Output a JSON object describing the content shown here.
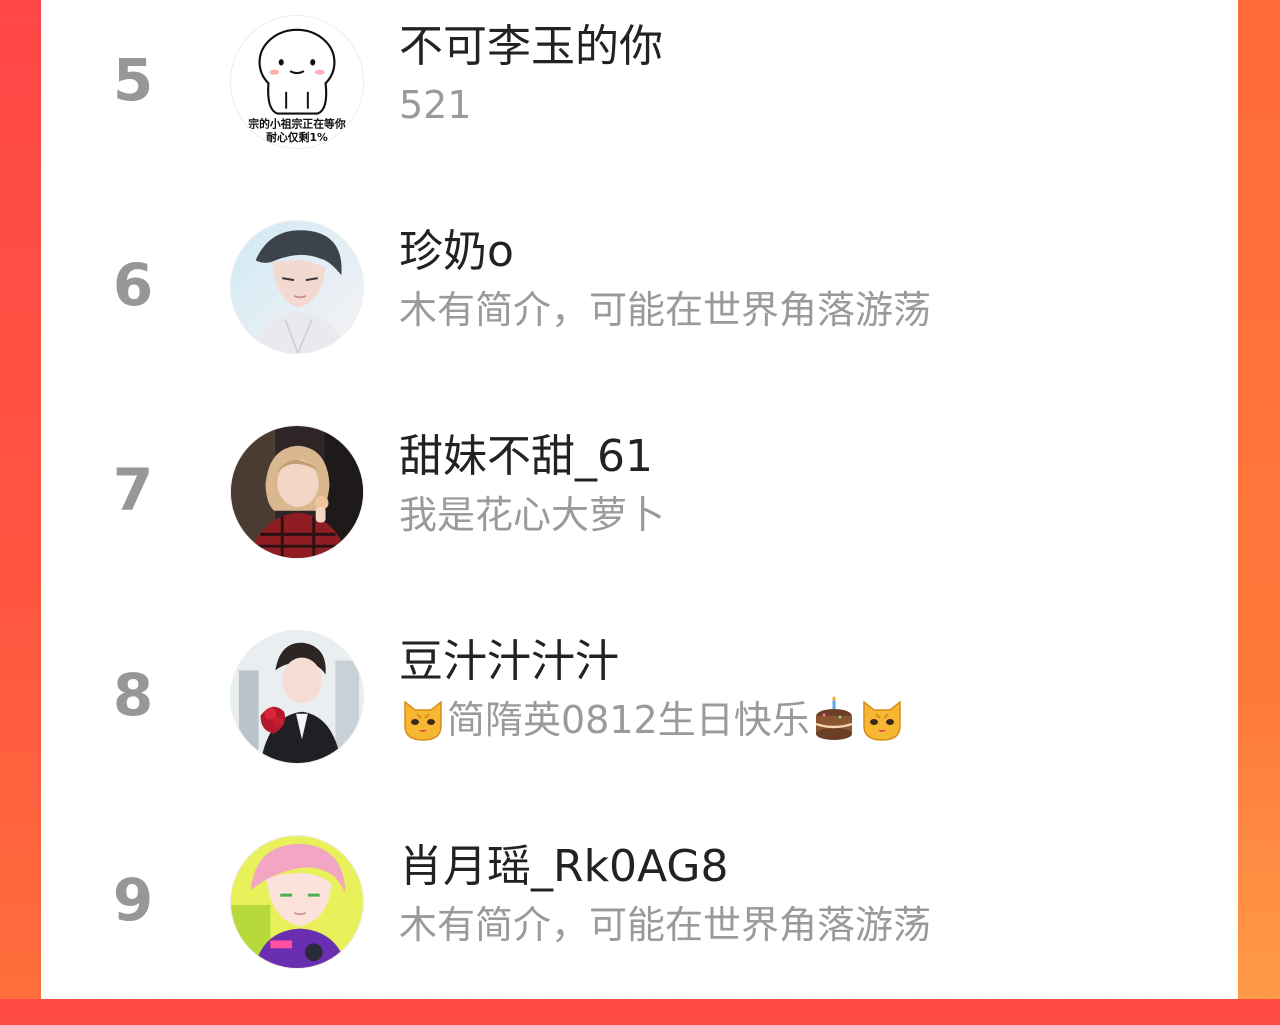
{
  "theme": {
    "accent": "#ff4a45",
    "rank_color": "#979797",
    "name_color": "#222222",
    "bio_color": "#9a9a9a"
  },
  "rows": [
    {
      "rank": "5",
      "name": "不可李玉的你",
      "bio": "521",
      "avatar": "cartoon-blob-avatar",
      "avatar_caption": [
        "宗的小祖宗正在等你",
        "耐心仅剩1%"
      ]
    },
    {
      "rank": "6",
      "name": "珍奶o",
      "bio": "木有简介，可能在世界角落游荡",
      "avatar": "anime-boy-avatar"
    },
    {
      "rank": "7",
      "name": "甜妹不甜_61",
      "bio": "我是花心大萝卜",
      "avatar": "photo-girl-avatar"
    },
    {
      "rank": "8",
      "name": "豆汁汁汁汁",
      "bio_parts": {
        "lead_icon": "cat-face-icon",
        "text": "简隋英0812生日快乐",
        "mid_icon": "birthday-cake-icon",
        "tail_icon": "cat-face-icon"
      },
      "avatar": "anime-suit-man-avatar"
    },
    {
      "rank": "9",
      "name": "肖月瑶_Rk0AG8",
      "bio": "木有简介，可能在世界角落游荡",
      "avatar": "anime-pink-hair-avatar"
    }
  ]
}
